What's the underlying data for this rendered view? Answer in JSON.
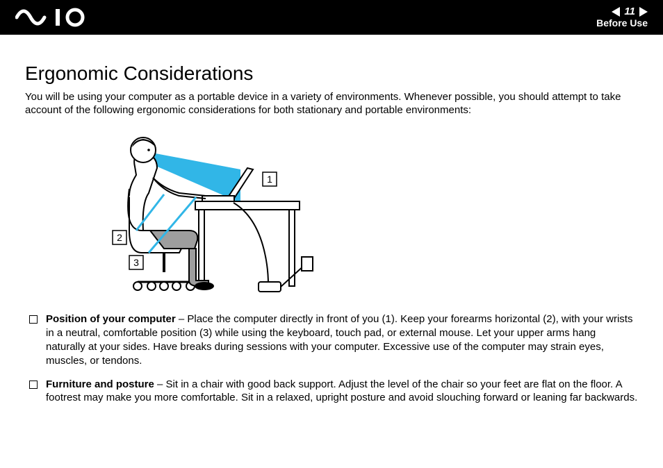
{
  "header": {
    "page_number": "11",
    "section": "Before Use"
  },
  "title": "Ergonomic Considerations",
  "intro": "You will be using your computer as a portable device in a variety of environments. Whenever possible, you should attempt to take account of the following ergonomic considerations for both stationary and portable environments:",
  "callouts": {
    "c1": "1",
    "c2": "2",
    "c3": "3"
  },
  "bullets": [
    {
      "title": "Position of your computer",
      "text": " – Place the computer directly in front of you (1). Keep your forearms horizontal (2), with your wrists in a neutral, comfortable position (3) while using the keyboard, touch pad, or external mouse. Let your upper arms hang naturally at your sides. Have breaks during sessions with your computer. Excessive use of the computer may strain eyes, muscles, or tendons."
    },
    {
      "title": "Furniture and posture",
      "text": " – Sit in a chair with good back support. Adjust the level of the chair so your feet are flat on the floor. A footrest may make you more comfortable. Sit in a relaxed, upright posture and avoid slouching forward or leaning far backwards."
    }
  ]
}
